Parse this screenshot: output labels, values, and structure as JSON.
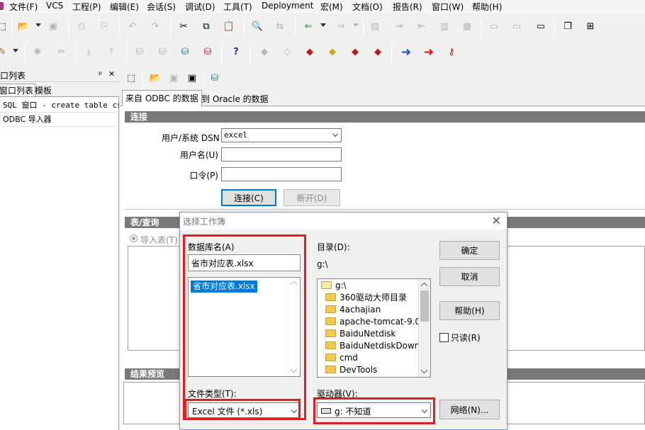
{
  "menubar": {
    "items": [
      "文件(F)",
      "VCS",
      "工程(P)",
      "编辑(E)",
      "会话(S)",
      "调试(D)",
      "工具(T)",
      "Deployment",
      "宏(M)",
      "文档(O)",
      "报告(R)",
      "窗口(W)",
      "帮助(H)"
    ]
  },
  "left_panel": {
    "title": "口列表",
    "pin": "ᵖ",
    "close": "✕",
    "tabs": [
      "窗口列表",
      "模板"
    ],
    "items": [
      "SQL 窗口 - create table csd",
      "ODBC 导入器"
    ]
  },
  "main": {
    "tabs": [
      "来自 ODBC 的数据",
      "到 Oracle 的数据"
    ],
    "connect_section": "连接",
    "dsn_label": "用户/系统 DSN",
    "dsn_value": "excel",
    "username_label": "用户名(U)",
    "password_label": "口令(P)",
    "connect_button": "连接(C)",
    "disconnect_button": "断开(D)",
    "table_section": "表/查询",
    "import_table_label": "导入表(T)",
    "results_section": "结果预览"
  },
  "dialog": {
    "title": "选择工作簿",
    "db_name_label": "数据库名(A)",
    "db_name_value": "省市对应表.xlsx",
    "db_list": [
      "省市对应表.xlsx"
    ],
    "dir_label": "目录(D):",
    "dir_value": "g:\\",
    "folders": [
      "g:\\",
      "360驱动大师目录",
      "4achajian",
      "apache-tomcat-9.0.",
      "BaiduNetdisk",
      "BaiduNetdiskDown",
      "cmd",
      "DevTools"
    ],
    "ok_button": "确定",
    "cancel_button": "取消",
    "help_button": "帮助(H)",
    "readonly_label": "只读(R)",
    "filetype_label": "文件类型(T):",
    "filetype_value": "Excel 文件 (*.xls)",
    "drive_label": "驱动器(V):",
    "drive_value": "g: 不知道",
    "network_button": "网络(N)...",
    "highlight_color": "#e02020"
  }
}
